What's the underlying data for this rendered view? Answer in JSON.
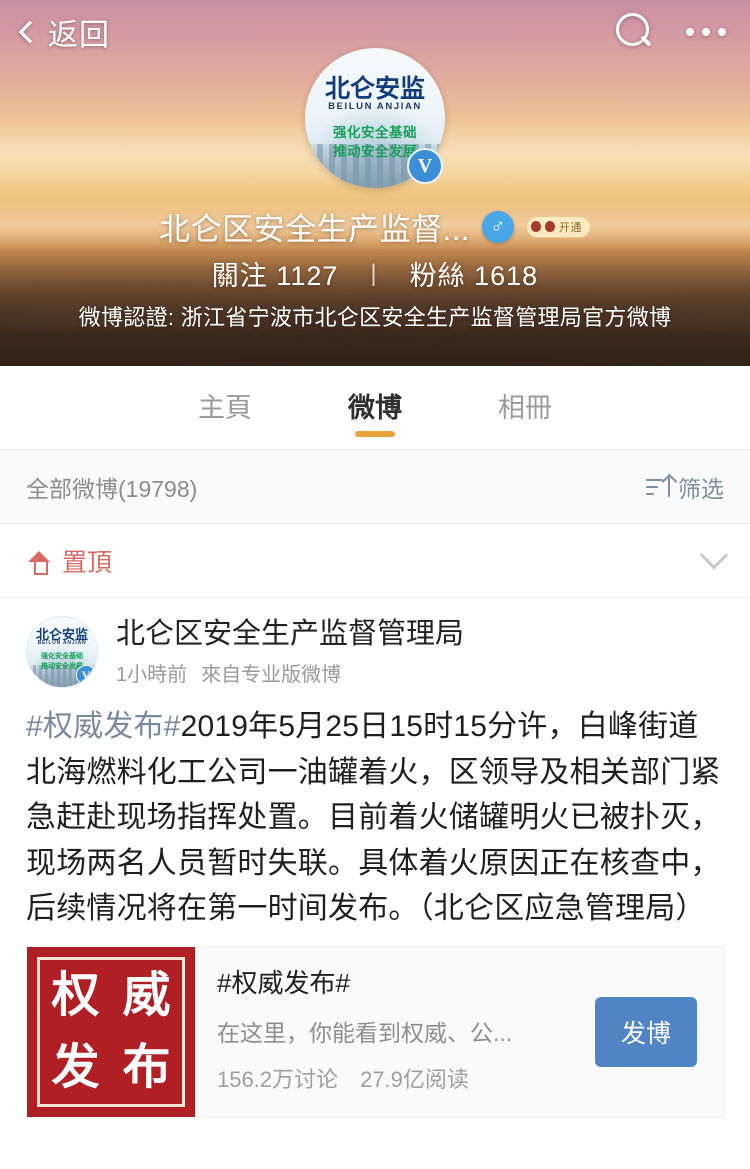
{
  "navbar": {
    "back_label": "返回",
    "search_icon": "search-icon",
    "more_icon": "more-horizontal-icon"
  },
  "profile": {
    "avatar": {
      "title": "北仑安监",
      "subtitle": "BEILUN ANJIAN",
      "slogan_line1": "强化安全基础",
      "slogan_line2": "推动安全发展",
      "verified_badge": "V"
    },
    "username": "北仑区安全生产监督...",
    "gender_icon": "male-gender-icon",
    "gender_symbol": "♂",
    "level_badge_label": "开通",
    "follows_label": "關注",
    "follows_count": "1127",
    "divider": "|",
    "fans_label": "粉絲",
    "fans_count": "1618",
    "verification": "微博認證: 浙江省宁波市北仑区安全生产监督管理局官方微博"
  },
  "tabs": [
    {
      "label": "主頁",
      "active": false
    },
    {
      "label": "微博",
      "active": true
    },
    {
      "label": "相冊",
      "active": false
    }
  ],
  "filter_bar": {
    "count_label": "全部微博(19798)",
    "filter_icon": "filter-sort-icon",
    "filter_label": "筛选"
  },
  "pinned_bar": {
    "pin_icon": "pin-to-top-icon",
    "label": "置頂",
    "chevron_icon": "chevron-down-icon"
  },
  "post": {
    "avatar": {
      "title": "北仑安监",
      "subtitle": "BEILUN ANJIAN",
      "slogan_line1": "强化安全基础",
      "slogan_line2": "推动安全发展",
      "verified_badge": "V"
    },
    "author": "北仑区安全生产监督管理局",
    "time": "1小時前",
    "source": "來自专业版微博",
    "hashtag": "#权威发布#",
    "body": "2019年5月25日15时15分许，白峰街道北海燃料化工公司一油罐着火，区领导及相关部门紧急赶赴现场指挥处置。目前着火储罐明火已被扑灭，现场两名人员暂时失联。具体着火原因正在核查中，后续情况将在第一时间发布。（北仑区应急管理局）"
  },
  "topic_card": {
    "thumb_chars": [
      "权",
      "威",
      "发",
      "布"
    ],
    "title": "#权威发布#",
    "description": "在这里，你能看到权威、公...",
    "discussions": "156.2万讨论",
    "reads": "27.9亿阅读",
    "button_label": "发博"
  },
  "colors": {
    "accent_orange": "#e8a33d",
    "pin_red": "#d96a63",
    "link_blue_gray": "#7a8a9c",
    "button_blue": "#5184c4",
    "topic_red": "#b01f24",
    "verified_blue": "#3c8fd6"
  }
}
